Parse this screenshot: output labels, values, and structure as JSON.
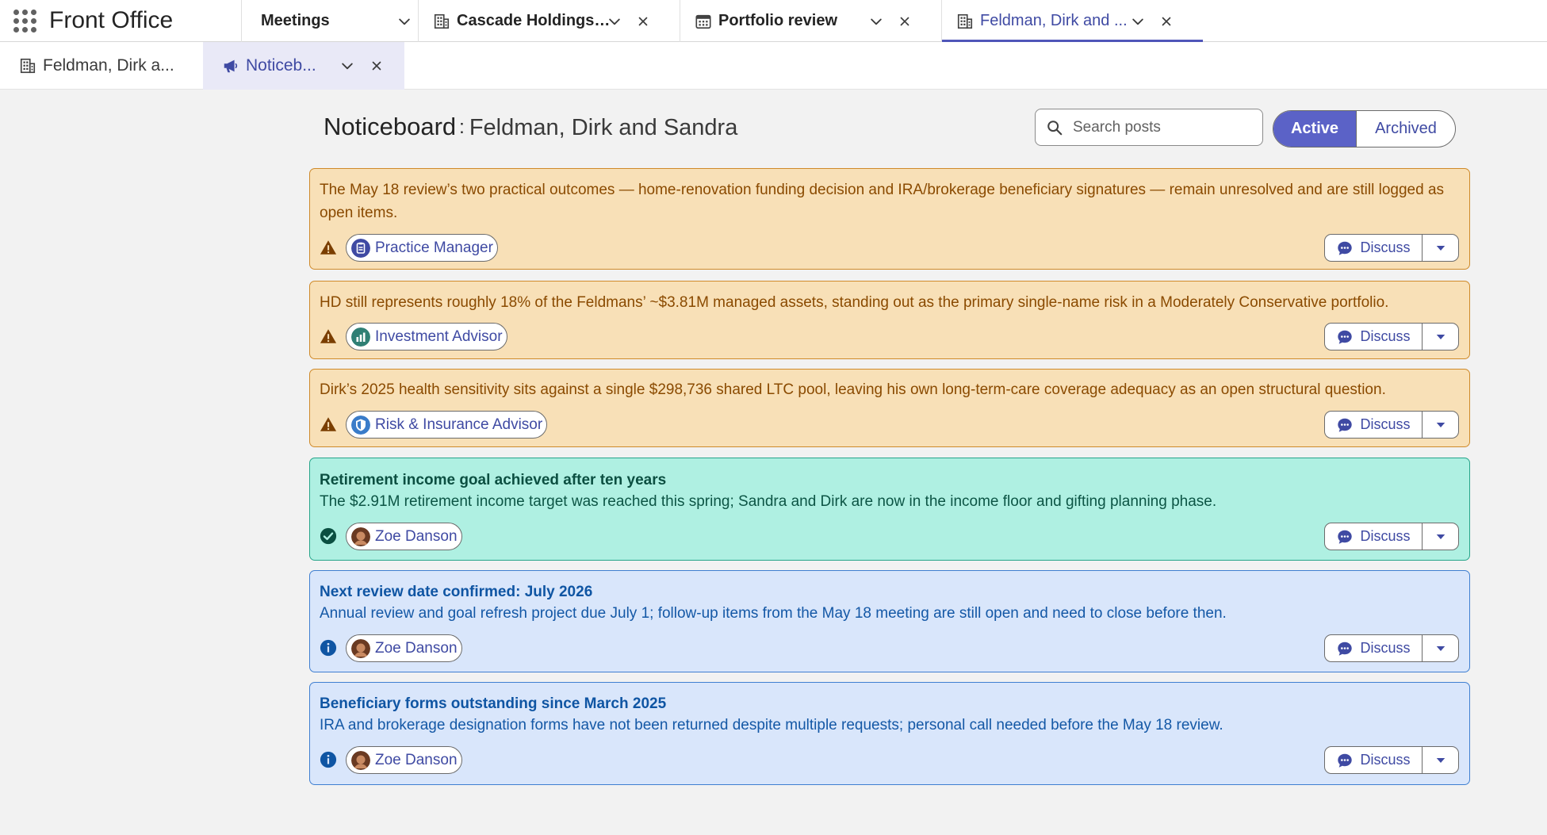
{
  "app": {
    "title": "Front Office"
  },
  "top_tabs": [
    {
      "label": "Meetings",
      "icon": "none"
    },
    {
      "label": "Cascade Holdings ...",
      "icon": "building-icon"
    },
    {
      "label": "Portfolio review",
      "icon": "calendar-icon"
    },
    {
      "label": "Feldman, Dirk and ...",
      "icon": "building-icon",
      "active": true
    }
  ],
  "sub_tabs": [
    {
      "label": "Feldman, Dirk a...",
      "icon": "building-icon"
    },
    {
      "label": "Noticeb...",
      "icon": "megaphone-icon",
      "active": true
    }
  ],
  "header": {
    "title": "Noticeboard",
    "separator": ":",
    "subtitle": "Feldman, Dirk and Sandra"
  },
  "search": {
    "placeholder": "Search posts",
    "value": ""
  },
  "filter": {
    "active_label": "Active",
    "archived_label": "Archived",
    "selected": "Active"
  },
  "discuss_label": "Discuss",
  "colors": {
    "accent": "#5b62c7",
    "warning_bg": "#f8e0b7",
    "success_bg": "#aff0e2",
    "info_bg": "#d9e6fb"
  },
  "posts": [
    {
      "type": "warning",
      "title": "",
      "body": "The May 18 review’s two practical outcomes — home-renovation funding decision and IRA/brokerage beneficiary signatures — remain unresolved and are still logged as open items.",
      "author": "Practice Manager",
      "author_icon": "clipboard-icon"
    },
    {
      "type": "warning",
      "title": "",
      "body": "HD still represents roughly 18% of the Feldmans’ ~$3.81M managed assets, standing out as the primary single-name risk in a Moderately Conservative portfolio.",
      "author": "Investment Advisor",
      "author_icon": "chart-icon"
    },
    {
      "type": "warning",
      "title": "",
      "body": "Dirk’s 2025 health sensitivity sits against a single $298,736 shared LTC pool, leaving his own long-term-care coverage adequacy as an open structural question.",
      "author": "Risk & Insurance Advisor",
      "author_icon": "shield-icon"
    },
    {
      "type": "success",
      "title": "Retirement income goal achieved after ten years",
      "body": "The $2.91M retirement income target was reached this spring; Sandra and Dirk are now in the income floor and gifting planning phase.",
      "author": "Zoe Danson",
      "author_icon": "avatar"
    },
    {
      "type": "info",
      "title": "Next review date confirmed: July 2026",
      "body": "Annual review and goal refresh project due July 1; follow-up items from the May 18 meeting are still open and need to close before then.",
      "author": "Zoe Danson",
      "author_icon": "avatar"
    },
    {
      "type": "info",
      "title": "Beneficiary forms outstanding since March 2025",
      "body": "IRA and brokerage designation forms have not been returned despite multiple requests; personal call needed before the May 18 review.",
      "author": "Zoe Danson",
      "author_icon": "avatar"
    }
  ]
}
